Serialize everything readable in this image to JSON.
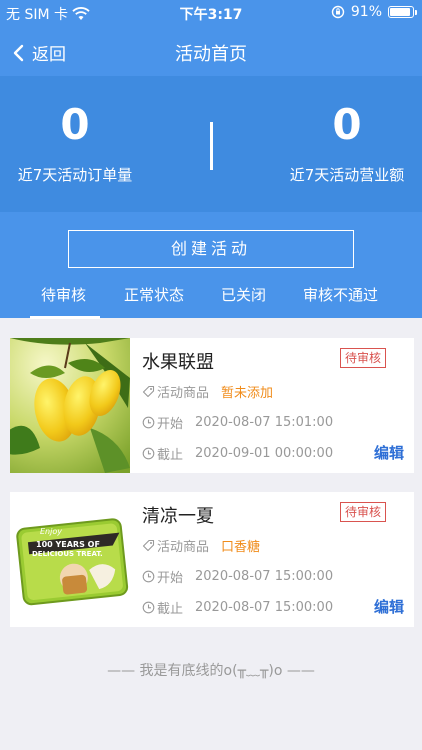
{
  "status_bar": {
    "carrier": "无 SIM 卡",
    "time": "下午3:17",
    "battery": "91%",
    "battery_level": 0.91
  },
  "nav": {
    "back_label": "返回",
    "title": "活动首页"
  },
  "stats": {
    "orders_value": "0",
    "orders_label": "近7天活动订单量",
    "revenue_value": "0",
    "revenue_label": "近7天活动营业额"
  },
  "create_button_label": "创建活动",
  "tabs": [
    {
      "label": "待审核",
      "active": true
    },
    {
      "label": "正常状态",
      "active": false
    },
    {
      "label": "已关闭",
      "active": false
    },
    {
      "label": "审核不通过",
      "active": false
    }
  ],
  "activities": [
    {
      "title": "水果联盟",
      "badge": "待审核",
      "goods_label": "活动商品",
      "goods_value": "暂未添加",
      "start_label": "开始",
      "start_time": "2020-08-07 15:01:00",
      "end_label": "截止",
      "end_time": "2020-09-01 00:00:00",
      "edit_label": "编辑"
    },
    {
      "title": "清凉一夏",
      "badge": "待审核",
      "goods_label": "活动商品",
      "goods_value": "口香糖",
      "start_label": "开始",
      "start_time": "2020-08-07 15:00:00",
      "end_label": "截止",
      "end_time": "2020-08-07 15:00:00",
      "edit_label": "编辑",
      "image_text": {
        "line1": "Enjoy",
        "line2": "100 YEARS OF",
        "line3": "DELICIOUS TREAT."
      }
    }
  ],
  "footer_text": "—— 我是有底线的o(╥﹏╥)o ——",
  "colors": {
    "primary": "#4a94ea",
    "stats_bg": "#3f8be0",
    "badge": "#d9534f",
    "accent_orange": "#f08c1b",
    "edit_blue": "#2e6fd6"
  },
  "icons": [
    "wifi-icon",
    "lock-rotation-icon",
    "battery-icon",
    "back-chevron-icon",
    "tag-icon",
    "clock-icon"
  ]
}
